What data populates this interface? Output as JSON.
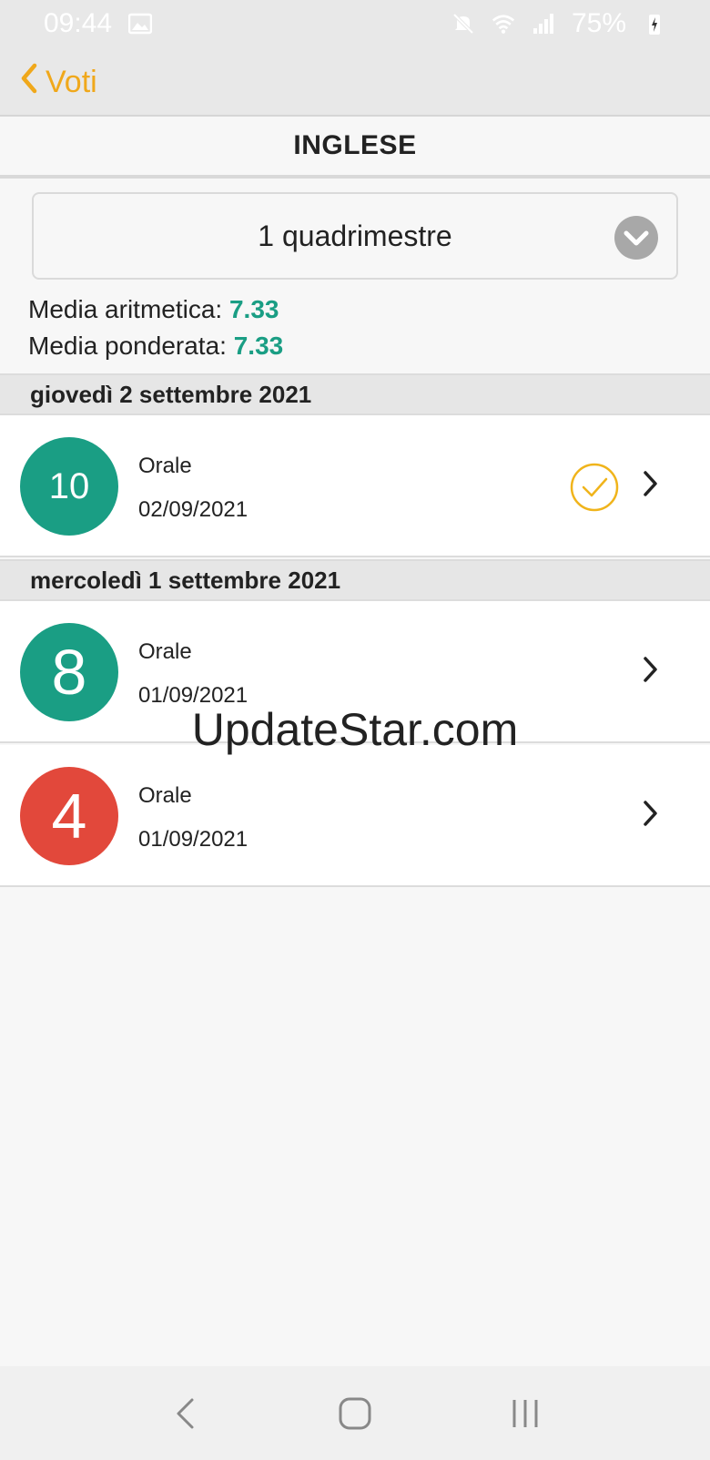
{
  "status_bar": {
    "time": "09:44",
    "battery": "75%"
  },
  "nav": {
    "back_label": "Voti"
  },
  "subject": {
    "title": "INGLESE"
  },
  "period": {
    "selected": "1 quadrimestre"
  },
  "averages": {
    "arithmetic_label": "Media aritmetica:",
    "arithmetic_value": "7.33",
    "weighted_label": "Media ponderata:",
    "weighted_value": "7.33"
  },
  "groups": [
    {
      "date_header": "giovedì 2 settembre 2021",
      "grades": [
        {
          "grade": "10",
          "type": "Orale",
          "date": "02/09/2021",
          "color": "#1a9e84",
          "seen": true
        }
      ]
    },
    {
      "date_header": "mercoledì 1 settembre 2021",
      "grades": [
        {
          "grade": "8",
          "type": "Orale",
          "date": "01/09/2021",
          "color": "#1a9e84",
          "seen": false
        },
        {
          "grade": "4",
          "type": "Orale",
          "date": "01/09/2021",
          "color": "#e2483b",
          "seen": false
        }
      ]
    }
  ],
  "watermark": "UpdateStar.com",
  "colors": {
    "accent": "#f0a81b",
    "good_grade": "#1a9e84",
    "bad_grade": "#e2483b"
  }
}
